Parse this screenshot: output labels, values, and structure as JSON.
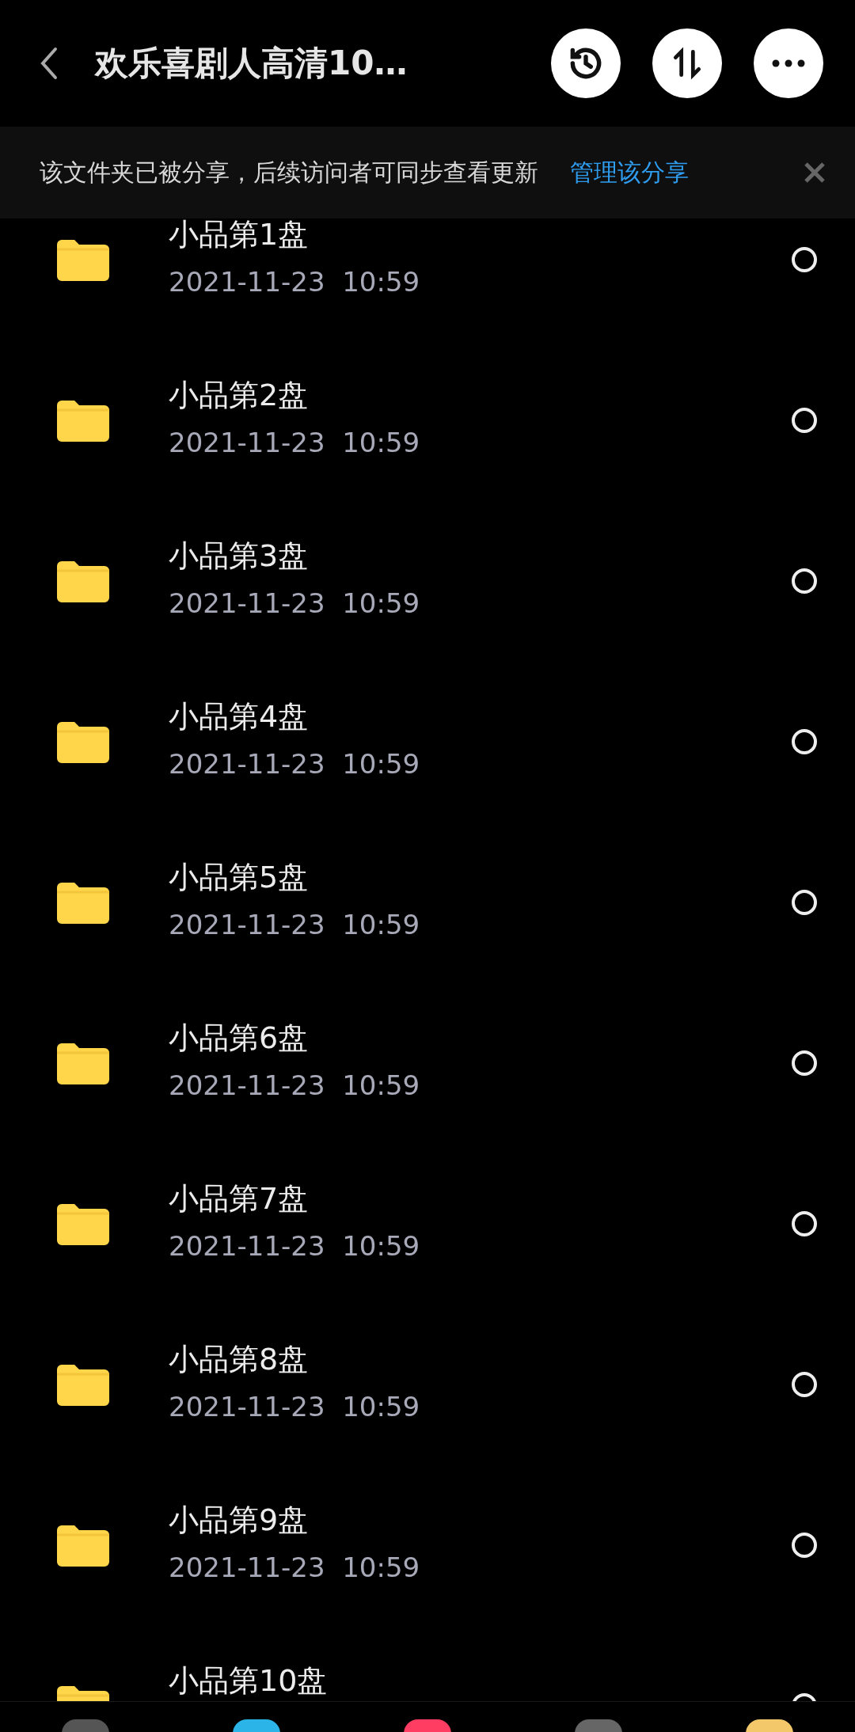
{
  "header": {
    "title": "欢乐喜剧人高清10…",
    "buttons": [
      {
        "kind": "history"
      },
      {
        "kind": "sort"
      },
      {
        "kind": "more"
      }
    ]
  },
  "share_banner": {
    "text": "该文件夹已被分享，后续访问者可同步查看更新",
    "link": "管理该分享"
  },
  "files": [
    {
      "name": "小品第1盘",
      "date": "2021-11-23  10:59",
      "selected": false
    },
    {
      "name": "小品第2盘",
      "date": "2021-11-23  10:59",
      "selected": false
    },
    {
      "name": "小品第3盘",
      "date": "2021-11-23  10:59",
      "selected": false
    },
    {
      "name": "小品第4盘",
      "date": "2021-11-23  10:59",
      "selected": false
    },
    {
      "name": "小品第5盘",
      "date": "2021-11-23  10:59",
      "selected": false
    },
    {
      "name": "小品第6盘",
      "date": "2021-11-23  10:59",
      "selected": false
    },
    {
      "name": "小品第7盘",
      "date": "2021-11-23  10:59",
      "selected": false
    },
    {
      "name": "小品第8盘",
      "date": "2021-11-23  10:59",
      "selected": false
    },
    {
      "name": "小品第9盘",
      "date": "2021-11-23  10:59",
      "selected": false
    },
    {
      "name": "小品第10盘",
      "selected": false
    }
  ]
}
